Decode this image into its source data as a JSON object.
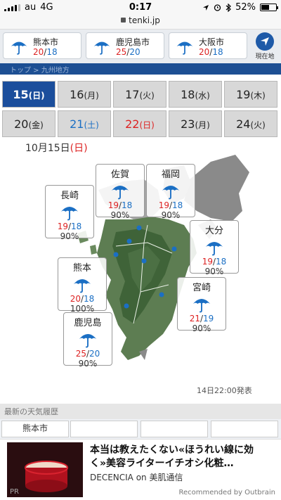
{
  "status": {
    "carrier": "au",
    "network": "4G",
    "time": "0:17",
    "battery": "52%"
  },
  "url": "tenki.jp",
  "cities": [
    {
      "name": "熊本市",
      "hi": "20",
      "lo": "18"
    },
    {
      "name": "鹿児島市",
      "hi": "25",
      "lo": "20"
    },
    {
      "name": "大阪市",
      "hi": "20",
      "lo": "18"
    }
  ],
  "location_label": "現在地",
  "band_text": "トップ > 九州地方",
  "dates_row1": [
    {
      "d": "15",
      "w": "(日)",
      "kind": "active"
    },
    {
      "d": "16",
      "w": "(月)",
      "kind": ""
    },
    {
      "d": "17",
      "w": "(火)",
      "kind": ""
    },
    {
      "d": "18",
      "w": "(水)",
      "kind": ""
    },
    {
      "d": "19",
      "w": "(木)",
      "kind": ""
    }
  ],
  "dates_row2": [
    {
      "d": "20",
      "w": "(金)",
      "kind": ""
    },
    {
      "d": "21",
      "w": "(土)",
      "kind": "sat"
    },
    {
      "d": "22",
      "w": "(日)",
      "kind": "sun"
    },
    {
      "d": "23",
      "w": "(月)",
      "kind": ""
    },
    {
      "d": "24",
      "w": "(火)",
      "kind": ""
    }
  ],
  "map": {
    "date_prefix": "10月15日",
    "date_day": "(日)",
    "issued": "14日22:00発表",
    "forecasts": [
      {
        "city": "佐賀",
        "hi": "19",
        "lo": "18",
        "pop": "90%"
      },
      {
        "city": "福岡",
        "hi": "19",
        "lo": "18",
        "pop": "90%"
      },
      {
        "city": "長崎",
        "hi": "19",
        "lo": "18",
        "pop": "90%"
      },
      {
        "city": "大分",
        "hi": "19",
        "lo": "18",
        "pop": "90%"
      },
      {
        "city": "熊本",
        "hi": "20",
        "lo": "18",
        "pop": "100%"
      },
      {
        "city": "宮崎",
        "hi": "21",
        "lo": "19",
        "pop": "90%"
      },
      {
        "city": "鹿児島",
        "hi": "25",
        "lo": "20",
        "pop": "90%"
      }
    ]
  },
  "history": {
    "title": "最新の天気履歴",
    "city": "熊本市"
  },
  "ad": {
    "headline": "本当は教えたくない«ほうれい線に効く»美容ライターイチオシ化粧…",
    "brand": "DECENCIA",
    "on": "on",
    "site": "美肌通信",
    "recommended": "Recommended by Outbrain",
    "pr": "PR"
  },
  "colors": {
    "header_blue": "#1d4f93",
    "active_date": "#1b4e9c",
    "rain_blue": "#1b6fc4",
    "hi_red": "#d22"
  }
}
